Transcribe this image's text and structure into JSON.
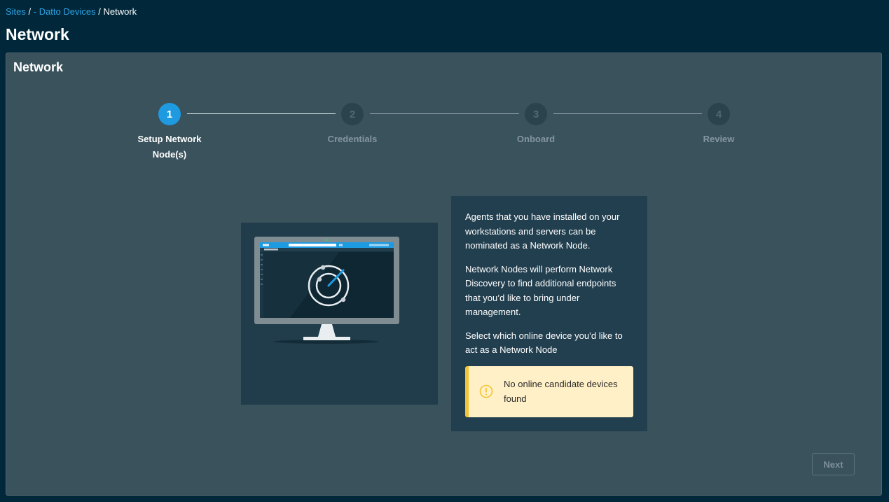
{
  "breadcrumb": {
    "items": [
      "Sites",
      "- Datto Devices",
      "Network"
    ],
    "separator": " / "
  },
  "page_title": "Network",
  "card": {
    "title": "Network"
  },
  "stepper": {
    "steps": [
      {
        "number": "1",
        "label": "Setup Network Node(s)",
        "active": true
      },
      {
        "number": "2",
        "label": "Credentials",
        "active": false
      },
      {
        "number": "3",
        "label": "Onboard",
        "active": false
      },
      {
        "number": "4",
        "label": "Review",
        "active": false
      }
    ]
  },
  "info": {
    "paragraphs": [
      "Agents that you have installed on your workstations and servers can be nominated as a Network Node.",
      "Network Nodes will perform Network Discovery to find additional endpoints that you’d like to bring under management.",
      "Select which online device you’d like to act as a Network Node"
    ],
    "warning": {
      "icon": "exclamation-circle-icon",
      "text": "No online candidate devices found"
    }
  },
  "next_button": "Next",
  "colors": {
    "page_bg": "#00283a",
    "card_bg": "#3a525c",
    "accent": "#1e9ae0",
    "link": "#2ea3e6",
    "warning_bg": "#fff0c7",
    "warning_accent": "#f3c433"
  }
}
